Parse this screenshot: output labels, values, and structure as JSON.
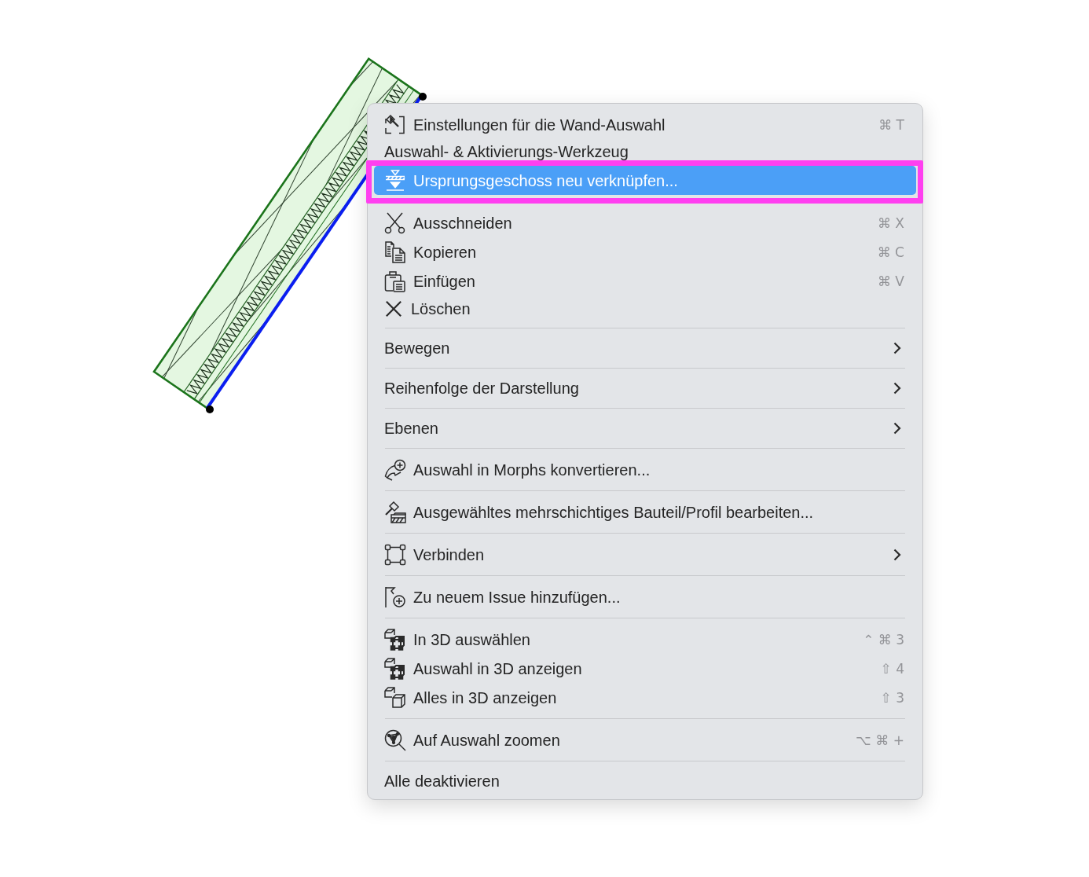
{
  "canvas": {
    "wall": {
      "selected": true
    }
  },
  "context_menu": {
    "sections": [
      {
        "items": [
          {
            "kind": "command",
            "label": "Einstellungen für die Wand-Auswahl",
            "shortcut": "⌘ T",
            "selected": false,
            "marked": false
          },
          {
            "kind": "command",
            "label": "Auswahl- & Aktivierungs-Werkzeug",
            "selected": false,
            "marked": false
          },
          {
            "kind": "command",
            "label": "Ursprungsgeschoss neu verknüpfen...",
            "selected": true,
            "marked": true
          }
        ]
      },
      {
        "items": [
          {
            "kind": "command",
            "label": "Ausschneiden",
            "shortcut": "⌘ X",
            "selected": false,
            "marked": false
          },
          {
            "kind": "command",
            "label": "Kopieren",
            "shortcut": "⌘ C",
            "selected": false,
            "marked": false
          },
          {
            "kind": "command",
            "label": "Einfügen",
            "shortcut": "⌘ V",
            "selected": false,
            "marked": false
          },
          {
            "kind": "command",
            "label": "Löschen",
            "selected": false,
            "marked": false
          }
        ]
      },
      {
        "items": [
          {
            "kind": "submenu",
            "label": "Bewegen",
            "selected": false,
            "marked": false
          }
        ]
      },
      {
        "items": [
          {
            "kind": "submenu",
            "label": "Reihenfolge der Darstellung",
            "selected": false,
            "marked": false
          }
        ]
      },
      {
        "items": [
          {
            "kind": "submenu",
            "label": "Ebenen",
            "selected": false,
            "marked": false
          }
        ]
      },
      {
        "items": [
          {
            "kind": "command",
            "label": "Auswahl in Morphs konvertieren...",
            "selected": false,
            "marked": false
          }
        ]
      },
      {
        "items": [
          {
            "kind": "command",
            "label": "Ausgewähltes mehrschichtiges Bauteil/Profil bearbeiten...",
            "selected": false,
            "marked": false
          }
        ]
      },
      {
        "items": [
          {
            "kind": "submenu",
            "label": "Verbinden",
            "selected": false,
            "marked": false
          }
        ]
      },
      {
        "items": [
          {
            "kind": "command",
            "label": "Zu neuem Issue hinzufügen...",
            "selected": false,
            "marked": false
          }
        ]
      },
      {
        "items": [
          {
            "kind": "command",
            "label": "In 3D auswählen",
            "shortcut": "⌃ ⌘ 3",
            "selected": false,
            "marked": false
          },
          {
            "kind": "command",
            "label": "Auswahl in 3D anzeigen",
            "shortcut": "⇧ 4",
            "selected": false,
            "marked": false
          },
          {
            "kind": "command",
            "label": "Alles in 3D anzeigen",
            "shortcut": "⇧ 3",
            "selected": false,
            "marked": false
          }
        ]
      },
      {
        "items": [
          {
            "kind": "command",
            "label": "Auf Auswahl zoomen",
            "shortcut": "⌥ ⌘ +",
            "selected": false,
            "marked": false
          }
        ]
      },
      {
        "items": [
          {
            "kind": "command",
            "label": "Alle deaktivieren",
            "selected": false,
            "marked": false
          }
        ]
      }
    ]
  }
}
